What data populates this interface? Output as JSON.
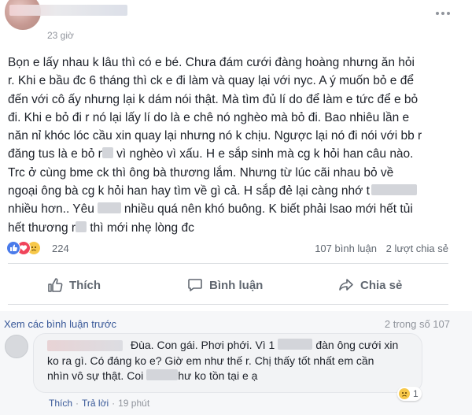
{
  "post": {
    "time": "23 giờ",
    "body": {
      "l1": "Bọn e lấy nhau k lâu thì có e bé. Chưa đám cưới đàng hoàng nhưng ăn hỏi",
      "l2": "r. Khi e bầu đc 6 tháng thì ck e đi làm và quay lại với nyc. A ý muốn bỏ e để",
      "l3": "đến với cô ấy nhưng lại k dám nói thật. Mà tìm đủ lí do để làm e tức để e bỏ",
      "l4": "đi. Khi e bỏ đi r nó lại lấy lí do là e chê nó nghèo mà bỏ đi. Bao nhiêu lần e",
      "l5": "năn nỉ khóc lóc cầu xin quay lại nhưng nó k chịu. Ngược lại nó đi nói với bb r",
      "l6a": "đăng tus là e bỏ r",
      "l6b": " vì nghèo vì xấu. H e sắp sinh mà cg k hỏi han câu nào.",
      "l7": "Trc ở cùng bme ck thì ông bà thương lắm. Nhưng từ lúc cãi nhau bỏ về",
      "l8": "ngoại ông bà cg k hỏi han hay tìm về gì cả. H sắp đẻ lại càng nhớ t",
      "l9a": "nhiều hơn.. Yêu",
      "l9b": "nhiều quá nên khó buông. K biết phải lsao mới hết tủi",
      "l10a": "hết thương r",
      "l10b": " thì mới nhẹ lòng đc"
    }
  },
  "reactions": {
    "count": "224",
    "comments": "107 bình luận",
    "shares": "2 lượt chia sẻ"
  },
  "actions": {
    "like": "Thích",
    "comment": "Bình luận",
    "share": "Chia sẻ"
  },
  "comments": {
    "view_previous": "Xem các bình luận trước",
    "count_of": "2 trong số 107",
    "first": {
      "l1": "Đùa. Con gái. Phơi phới. Vì 1",
      "l1b": "đàn ông cưới xin",
      "l2": "ko ra gì. Có đáng ko e? Giờ em như thế r. Chị thấy tốt nhất em cần",
      "l3a": "nhìn vô sự thật. Coi",
      "l3b": "hư ko tồn tại e ạ",
      "reaction_count": "1",
      "like": "Thích",
      "reply": "Trả lời",
      "time": "19 phút"
    }
  },
  "colors": {
    "link": "#385898",
    "muted": "#90949c",
    "like_blue": "#4a7bea",
    "love_red": "#f0445a",
    "sad_yellow": "#f7c84a"
  }
}
